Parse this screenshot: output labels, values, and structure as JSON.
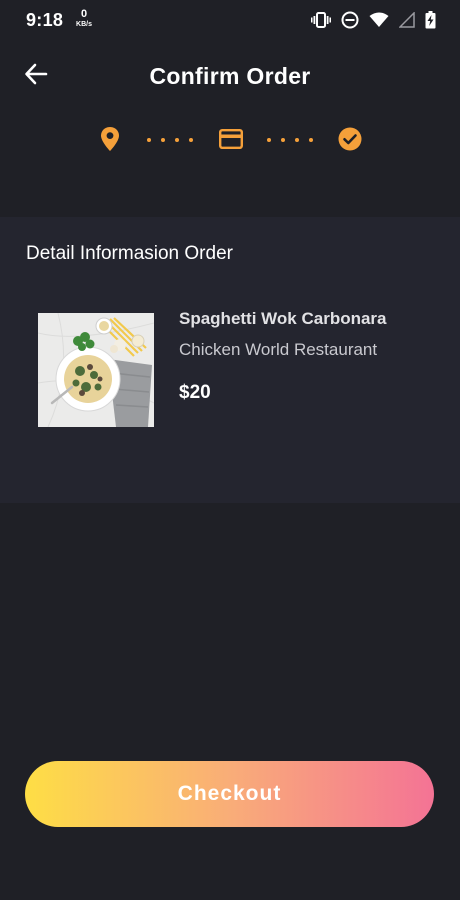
{
  "status_bar": {
    "time": "9:18",
    "net_speed": "0",
    "net_unit": "KB/s",
    "icons": [
      "vibrate-icon",
      "do-not-disturb-icon",
      "wifi-icon",
      "signal-icon",
      "battery-charging-icon"
    ]
  },
  "header": {
    "title": "Confirm Order",
    "back_icon": "arrow-left-icon"
  },
  "stepper": {
    "steps": [
      "location-pin-icon",
      "credit-card-icon",
      "check-circle-icon"
    ],
    "color": "#f5a03a"
  },
  "detail": {
    "section_title": "Detail Informasion Order",
    "item": {
      "name": "Spaghetti Wok Carbonara",
      "restaurant": "Chicken World Restaurant",
      "price": "$20"
    }
  },
  "checkout": {
    "label": "Checkout",
    "gradient": [
      "#fede45",
      "#f9ad78",
      "#f47395"
    ]
  },
  "colors": {
    "background": "#1f2026",
    "panel": "#24252f",
    "accent": "#f5a03a"
  }
}
